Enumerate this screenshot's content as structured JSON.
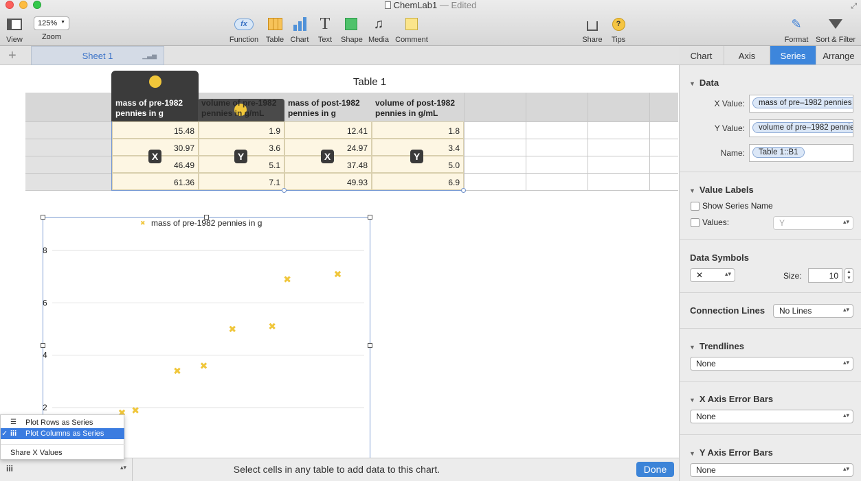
{
  "window": {
    "title": "ChemLab1",
    "edited": "— Edited"
  },
  "toolbar": {
    "view": "View",
    "zoom_value": "125%",
    "zoom": "Zoom",
    "function": "Function",
    "function_glyph": "fx",
    "table": "Table",
    "chart": "Chart",
    "text": "Text",
    "text_glyph": "T",
    "shape": "Shape",
    "media": "Media",
    "comment": "Comment",
    "share": "Share",
    "tips": "Tips",
    "tips_glyph": "?",
    "format": "Format",
    "sort_filter": "Sort & Filter"
  },
  "sheet_tab": "Sheet 1",
  "add_sheet_glyph": "+",
  "table": {
    "title": "Table 1",
    "headers": [
      "mass of pre-1982 pennies in g",
      "volume of pre-1982 pennies in g/mL",
      "mass of post-1982 pennies in g",
      "volume of post-1982 pennies in g/mL"
    ],
    "rows": [
      [
        "15.48",
        "1.9",
        "12.41",
        "1.8"
      ],
      [
        "30.97",
        "3.6",
        "24.97",
        "3.4"
      ],
      [
        "46.49",
        "5.1",
        "37.48",
        "5.0"
      ],
      [
        "61.36",
        "7.1",
        "49.93",
        "6.9"
      ]
    ],
    "badges": [
      "X",
      "Y",
      "X",
      "Y"
    ]
  },
  "chart_data": {
    "type": "scatter",
    "legend": "mass of pre-1982 pennies in g",
    "marker": "✖",
    "color": "#f0c63a",
    "y_ticks": [
      "8",
      "6",
      "4",
      "2"
    ],
    "ylim": [
      0,
      8
    ],
    "points": [
      {
        "x": 15.48,
        "y": 1.9
      },
      {
        "x": 12.41,
        "y": 1.8
      },
      {
        "x": 30.97,
        "y": 3.6
      },
      {
        "x": 24.97,
        "y": 3.4
      },
      {
        "x": 46.49,
        "y": 5.1
      },
      {
        "x": 37.48,
        "y": 5.0
      },
      {
        "x": 61.36,
        "y": 7.1
      },
      {
        "x": 49.93,
        "y": 6.9
      }
    ]
  },
  "popup_menu": {
    "rows": "Plot Rows as Series",
    "columns": "Plot Columns as Series",
    "check": "✓",
    "share_x": "Share X Values"
  },
  "bottom": {
    "series_glyph": "iii",
    "hint": "Select cells in any table to add data to this chart.",
    "done": "Done"
  },
  "panel": {
    "tabs": [
      "Chart",
      "Axis",
      "Series",
      "Arrange"
    ],
    "data_section": "Data",
    "x_value_label": "X Value:",
    "x_value": "mass of pre–1982 pennies in g",
    "y_value_label": "Y Value:",
    "y_value": "volume of pre–1982 pennies in g/mL",
    "name_label": "Name:",
    "name_value": "Table 1::B1",
    "value_labels": "Value Labels",
    "show_series_name": "Show Series Name",
    "values_label": "Values:",
    "values_select": "Y",
    "data_symbols": "Data Symbols",
    "symbol_value": "✕",
    "size_label": "Size:",
    "size_value": "10",
    "connection_lines": "Connection Lines",
    "connection_value": "No Lines",
    "trendlines": "Trendlines",
    "trendlines_value": "None",
    "x_error": "X Axis Error Bars",
    "x_error_value": "None",
    "y_error": "Y Axis Error Bars",
    "y_error_value": "None"
  }
}
